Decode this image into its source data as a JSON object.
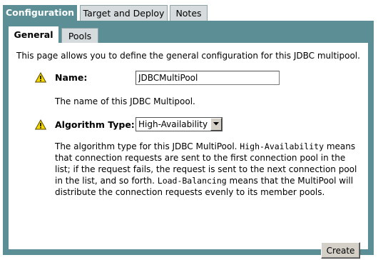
{
  "top_tabs": [
    {
      "label": "Configuration",
      "active": true
    },
    {
      "label": "Target and Deploy",
      "active": false
    },
    {
      "label": "Notes",
      "active": false
    }
  ],
  "sub_tabs": [
    {
      "label": "General",
      "active": true
    },
    {
      "label": "Pools",
      "active": false
    }
  ],
  "intro": "This page allows you to define the general configuration for this JDBC multipool.",
  "fields": {
    "name": {
      "label": "Name:",
      "value": "JDBCMultiPool",
      "help": "The name of this JDBC Multipool.",
      "icon": "warning-icon"
    },
    "algorithm": {
      "label": "Algorithm Type:",
      "selected": "High-Availability",
      "icon": "warning-icon",
      "help_parts": [
        {
          "text": "The algorithm type for this JDBC MultiPool. ",
          "mono": false
        },
        {
          "text": "High-Availability",
          "mono": true
        },
        {
          "text": " means that connection requests are sent to the first connection pool in the list; if the request fails, the request is sent to the next connection pool in the list, and so forth. ",
          "mono": false
        },
        {
          "text": "Load-Balancing",
          "mono": true
        },
        {
          "text": " means that the MultiPool will distribute the connection requests evenly to its member pools.",
          "mono": false
        }
      ]
    }
  },
  "buttons": {
    "create": "Create"
  },
  "colors": {
    "accent": "#5b8f95",
    "inactive_tab": "#d6dcdd",
    "warning": "#f2d600"
  }
}
